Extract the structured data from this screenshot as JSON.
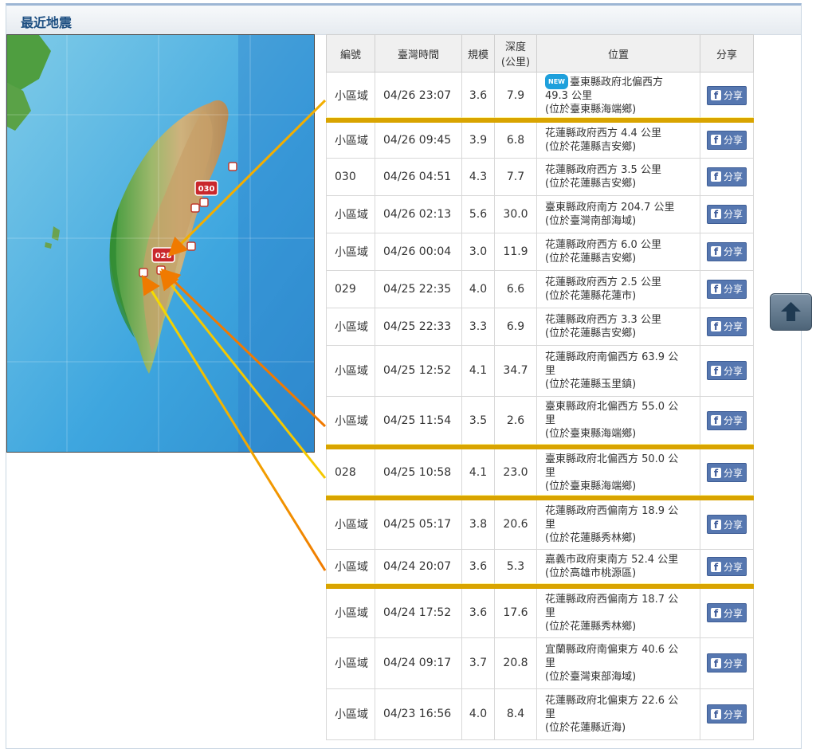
{
  "panel": {
    "title": "最近地震"
  },
  "table": {
    "headers": {
      "id": "編號",
      "time": "臺灣時間",
      "mag": "規模",
      "depth_line1": "深度",
      "depth_line2": "(公里)",
      "location": "位置",
      "share": "分享"
    },
    "new_tag": "NEW",
    "share_label": "分享",
    "rows": [
      {
        "id": "小區域",
        "time": "04/26 23:07",
        "mag": "3.6",
        "depth": "7.9",
        "loc1": "臺東縣政府北偏西方",
        "loc2": "49.3 公里",
        "loc3": "(位於臺東縣海端鄉)"
      },
      {
        "id": "小區域",
        "time": "04/26 09:45",
        "mag": "3.9",
        "depth": "6.8",
        "loc1": "花蓮縣政府西方 4.4 公里",
        "loc2": "(位於花蓮縣吉安鄉)"
      },
      {
        "id": "030",
        "time": "04/26 04:51",
        "mag": "4.3",
        "depth": "7.7",
        "loc1": "花蓮縣政府西方 3.5 公里",
        "loc2": "(位於花蓮縣吉安鄉)"
      },
      {
        "id": "小區域",
        "time": "04/26 02:13",
        "mag": "5.6",
        "depth": "30.0",
        "loc1": "臺東縣政府南方 204.7 公里",
        "loc2": "(位於臺灣南部海域)"
      },
      {
        "id": "小區域",
        "time": "04/26 00:04",
        "mag": "3.0",
        "depth": "11.9",
        "loc1": "花蓮縣政府西方 6.0 公里",
        "loc2": "(位於花蓮縣吉安鄉)"
      },
      {
        "id": "029",
        "time": "04/25 22:35",
        "mag": "4.0",
        "depth": "6.6",
        "loc1": "花蓮縣政府西方 2.5 公里",
        "loc2": "(位於花蓮縣花蓮市)"
      },
      {
        "id": "小區域",
        "time": "04/25 22:33",
        "mag": "3.3",
        "depth": "6.9",
        "loc1": "花蓮縣政府西方 3.3 公里",
        "loc2": "(位於花蓮縣吉安鄉)"
      },
      {
        "id": "小區域",
        "time": "04/25 12:52",
        "mag": "4.1",
        "depth": "34.7",
        "loc1": "花蓮縣政府南偏西方 63.9 公",
        "loc2": "里",
        "loc3": "(位於花蓮縣玉里鎮)"
      },
      {
        "id": "小區域",
        "time": "04/25 11:54",
        "mag": "3.5",
        "depth": "2.6",
        "loc1": "臺東縣政府北偏西方 55.0 公",
        "loc2": "里",
        "loc3": "(位於臺東縣海端鄉)"
      },
      {
        "id": "028",
        "time": "04/25 10:58",
        "mag": "4.1",
        "depth": "23.0",
        "loc1": "臺東縣政府北偏西方 50.0 公",
        "loc2": "里",
        "loc3": "(位於臺東縣海端鄉)"
      },
      {
        "id": "小區域",
        "time": "04/25 05:17",
        "mag": "3.8",
        "depth": "20.6",
        "loc1": "花蓮縣政府西偏南方 18.9 公",
        "loc2": "里",
        "loc3": "(位於花蓮縣秀林鄉)"
      },
      {
        "id": "小區域",
        "time": "04/24 20:07",
        "mag": "3.6",
        "depth": "5.3",
        "loc1": "嘉義市政府東南方 52.4 公里",
        "loc2": "(位於高雄市桃源區)"
      },
      {
        "id": "小區域",
        "time": "04/24 17:52",
        "mag": "3.6",
        "depth": "17.6",
        "loc1": "花蓮縣政府西偏南方 18.7 公",
        "loc2": "里",
        "loc3": "(位於花蓮縣秀林鄉)"
      },
      {
        "id": "小區域",
        "time": "04/24 09:17",
        "mag": "3.7",
        "depth": "20.8",
        "loc1": "宜蘭縣政府南偏東方 40.6 公",
        "loc2": "里",
        "loc3": "(位於臺灣東部海域)"
      },
      {
        "id": "小區域",
        "time": "04/23 16:56",
        "mag": "4.0",
        "depth": "8.4",
        "loc1": "花蓮縣政府北偏東方 22.6 公",
        "loc2": "里",
        "loc3": "(位於花蓮縣近海)"
      }
    ]
  },
  "map": {
    "markers": [
      {
        "label": "030"
      },
      {
        "label": "028"
      }
    ]
  },
  "colors": {
    "title": "#1d4f82",
    "highlight_line": "#d9a400",
    "share_bg": "#5677b0",
    "arrow_orange": "#f07a00",
    "arrow_yellow": "#f5e100"
  },
  "icons": {
    "share": "facebook-f-icon",
    "top": "arrow-up-icon"
  }
}
